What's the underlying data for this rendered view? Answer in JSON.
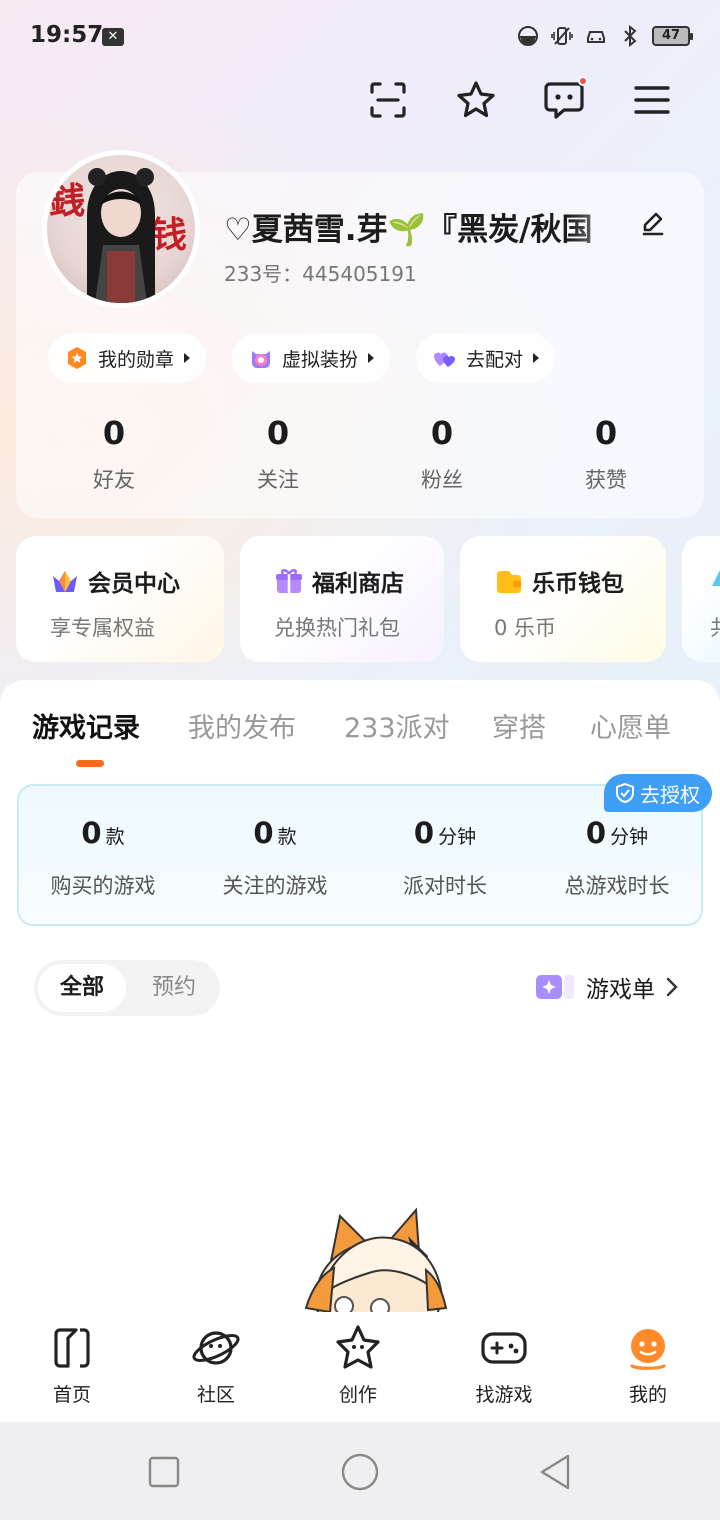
{
  "status_bar": {
    "time": "19:57",
    "battery": "47"
  },
  "profile": {
    "nickname": "♡夏茜雪.芽🌱『黑炭/秋国",
    "uid": "233号：445405191"
  },
  "chips": [
    {
      "label": "我的勋章"
    },
    {
      "label": "虚拟装扮"
    },
    {
      "label": "去配对"
    }
  ],
  "stats": [
    {
      "value": "0",
      "label": "好友"
    },
    {
      "value": "0",
      "label": "关注"
    },
    {
      "value": "0",
      "label": "粉丝"
    },
    {
      "value": "0",
      "label": "获赞"
    }
  ],
  "features": [
    {
      "title": "会员中心",
      "subtitle": "享专属权益"
    },
    {
      "title": "福利商店",
      "subtitle": "兑换热门礼包"
    },
    {
      "title": "乐币钱包",
      "subtitle": "0 乐币"
    },
    {
      "title": "",
      "subtitle": "共"
    }
  ],
  "tabs": [
    "游戏记录",
    "我的发布",
    "233派对",
    "穿搭",
    "心愿单"
  ],
  "auth_label": "去授权",
  "records": [
    {
      "value": "0",
      "unit": "款",
      "label": "购买的游戏"
    },
    {
      "value": "0",
      "unit": "款",
      "label": "关注的游戏"
    },
    {
      "value": "0",
      "unit": "分钟",
      "label": "派对时长"
    },
    {
      "value": "0",
      "unit": "分钟",
      "label": "总游戏时长"
    }
  ],
  "filter": {
    "all": "全部",
    "reserve": "预约"
  },
  "game_list_label": "游戏单",
  "bottom_nav": [
    {
      "label": "首页"
    },
    {
      "label": "社区"
    },
    {
      "label": "创作"
    },
    {
      "label": "找游戏"
    },
    {
      "label": "我的"
    }
  ],
  "colors": {
    "accent": "#ff6a1f",
    "auth": "#3f9ef5",
    "text": "#1c1c1c"
  }
}
